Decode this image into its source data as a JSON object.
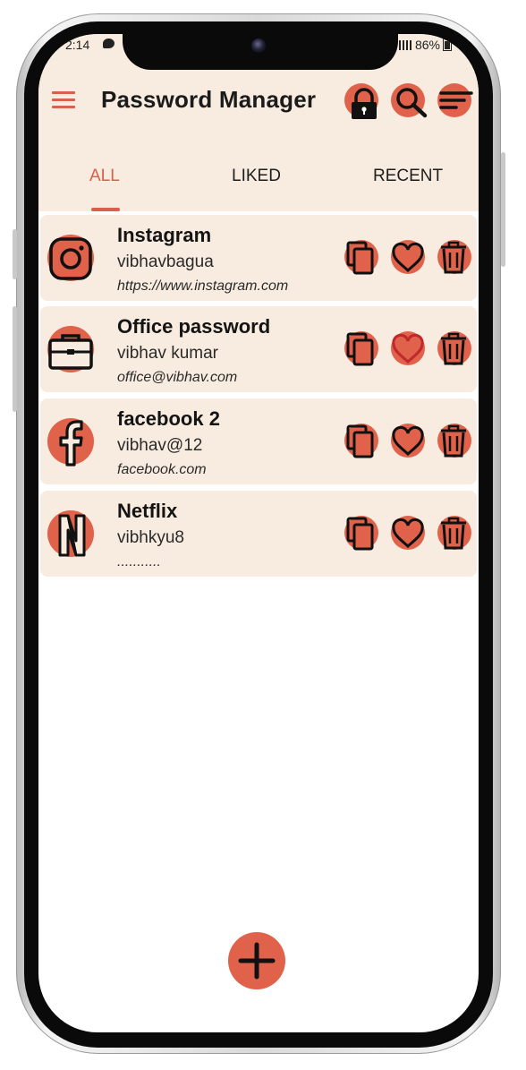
{
  "status_bar": {
    "time": "2:14",
    "battery": "86%"
  },
  "app_bar": {
    "title": "Password Manager"
  },
  "tabs": [
    {
      "label": "ALL",
      "active": true
    },
    {
      "label": "LIKED",
      "active": false
    },
    {
      "label": "RECENT",
      "active": false
    }
  ],
  "entries": [
    {
      "name": "Instagram",
      "username": "vibhavbagua",
      "url": "https://www.instagram.com",
      "icon": "instagram-icon",
      "liked": false
    },
    {
      "name": "Office password",
      "username": "vibhav kumar",
      "url": "office@vibhav.com",
      "icon": "briefcase-icon",
      "liked": true
    },
    {
      "name": "facebook 2",
      "username": "vibhav@12",
      "url": "facebook.com",
      "icon": "facebook-icon",
      "liked": false
    },
    {
      "name": "Netflix",
      "username": "vibhkyu8",
      "url": "...........",
      "icon": "netflix-icon",
      "liked": false
    }
  ],
  "colors": {
    "accent": "#e0624b",
    "card_bg": "#f8ece0",
    "liked_heart": "#c0282e"
  }
}
